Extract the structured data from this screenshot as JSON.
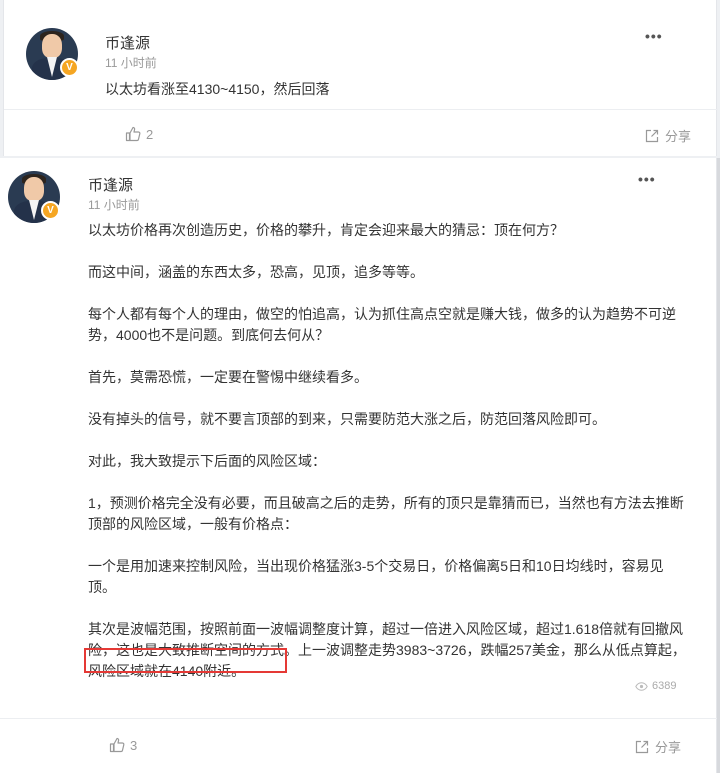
{
  "posts": [
    {
      "author": "币逢源",
      "verified_badge": "V",
      "time": "11 小时前",
      "content": "以太坊看涨至4130~4150，然后回落",
      "more_icon": "more-dots-icon",
      "likes": "2",
      "share_label": "分享"
    },
    {
      "author": "币逢源",
      "verified_badge": "V",
      "time": "11 小时前",
      "paragraphs": [
        "以太坊价格再次创造历史，价格的攀升，肯定会迎来最大的猜忌：顶在何方？",
        "而这中间，涵盖的东西太多，恐高，见顶，追多等等。",
        "每个人都有每个人的理由，做空的怕追高，认为抓住高点空就是赚大钱，做多的认为趋势不可逆势，4000也不是问题。到底何去何从？",
        "首先，莫需恐慌，一定要在警惕中继续看多。",
        "没有掉头的信号，就不要言顶部的到来，只需要防范大涨之后，防范回落风险即可。",
        "对此，我大致提示下后面的风险区域：",
        "1，预测价格完全没有必要，而且破高之后的走势，所有的顶只是靠猜而已，当然也有方法去推断顶部的风险区域，一般有价格点：",
        "一个是用加速来控制风险，当出现价格猛涨3-5个交易日，价格偏离5日和10日均线时，容易见顶。",
        "其次是波幅范围，按照前面一波幅调整度计算，超过一倍进入风险区域，超过1.618倍就有回撤风险，这也是大致推断空间的方式。上一波调整走势3983~3726，跌幅257美金，那么从低点算起，风险区域就在4140附近。"
      ],
      "views": "6389",
      "likes": "3",
      "share_label": "分享"
    }
  ],
  "colors": {
    "highlight": "#e53935",
    "badge": "#f5a623"
  }
}
